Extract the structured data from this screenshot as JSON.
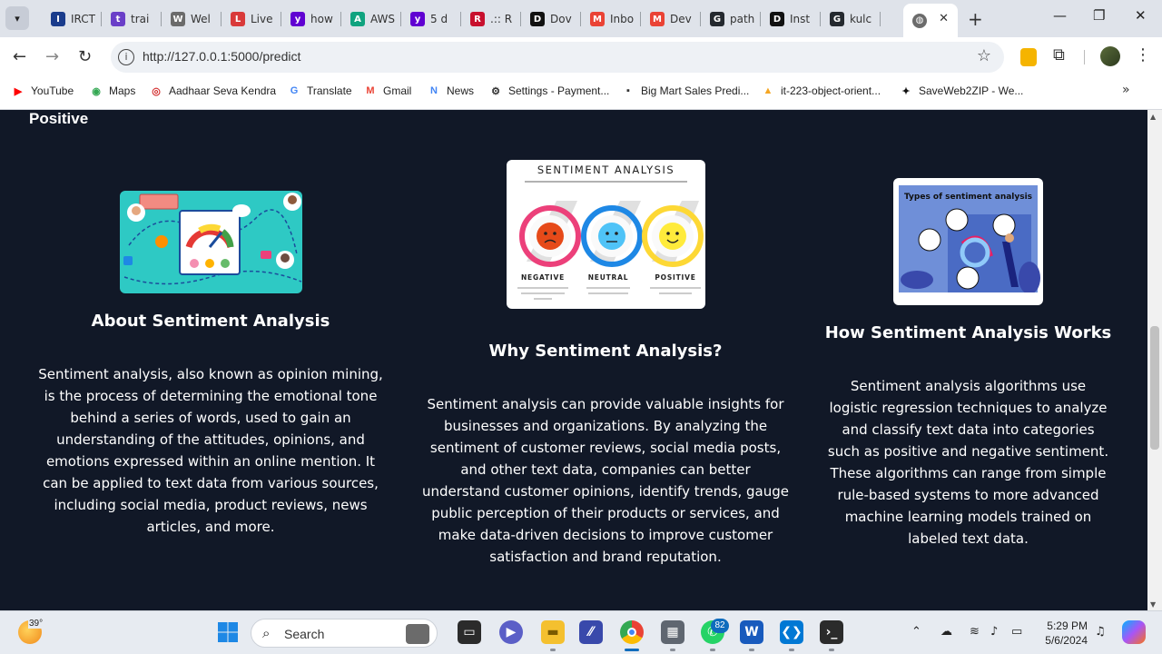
{
  "browser": {
    "tabs": [
      {
        "label": "IRCT",
        "color": "#1a3c8c",
        "glyph": "I"
      },
      {
        "label": "trai",
        "color": "#6a3fc8",
        "glyph": "t"
      },
      {
        "label": "Wel",
        "color": "#6b6b6b",
        "glyph": "W"
      },
      {
        "label": "Live",
        "color": "#d93a3a",
        "glyph": "L"
      },
      {
        "label": "how",
        "color": "#6001d2",
        "glyph": "y"
      },
      {
        "label": "AWS",
        "color": "#10a37f",
        "glyph": "A"
      },
      {
        "label": "5 d",
        "color": "#6001d2",
        "glyph": "y"
      },
      {
        "label": ".:: R",
        "color": "#c8102e",
        "glyph": "R"
      },
      {
        "label": "Dov",
        "color": "#111111",
        "glyph": "D"
      },
      {
        "label": "Inbo",
        "color": "#ea4335",
        "glyph": "M"
      },
      {
        "label": "Dev",
        "color": "#ea4335",
        "glyph": "M"
      },
      {
        "label": "path",
        "color": "#24292f",
        "glyph": "G"
      },
      {
        "label": "Inst",
        "color": "#111111",
        "glyph": "D"
      },
      {
        "label": "kulc",
        "color": "#24292f",
        "glyph": "G"
      }
    ],
    "url": "http://127.0.0.1:5000/predict",
    "bookmarks": [
      {
        "label": "YouTube",
        "icon": "youtube-icon",
        "color": "#ff0000",
        "glyph": "▶"
      },
      {
        "label": "Maps",
        "icon": "maps-icon",
        "color": "#34a853",
        "glyph": "◉"
      },
      {
        "label": "Aadhaar Seva Kendra",
        "icon": "aadhaar-icon",
        "color": "#d32f2f",
        "glyph": "◎"
      },
      {
        "label": "Translate",
        "icon": "translate-icon",
        "color": "#4285f4",
        "glyph": "G"
      },
      {
        "label": "Gmail",
        "icon": "gmail-icon",
        "color": "#ea4335",
        "glyph": "M"
      },
      {
        "label": "News",
        "icon": "news-icon",
        "color": "#4285f4",
        "glyph": "N"
      },
      {
        "label": "Settings - Payment...",
        "icon": "gear-icon",
        "color": "#333333",
        "glyph": "⚙"
      },
      {
        "label": "Big Mart Sales Predi...",
        "icon": "terminal-icon",
        "color": "#333333",
        "glyph": "▪"
      },
      {
        "label": "it-223-object-orient...",
        "icon": "warning-icon",
        "color": "#f5a623",
        "glyph": "▲"
      },
      {
        "label": "SaveWeb2ZIP - We...",
        "icon": "saveweb-icon",
        "color": "#111111",
        "glyph": "✦"
      }
    ]
  },
  "page": {
    "result_label": "Positive",
    "about": {
      "title": "About Sentiment Analysis",
      "body": "Sentiment analysis, also known as opinion mining, is the process of determining the emotional tone behind a series of words, used to gain an understanding of the attitudes, opinions, and emotions expressed within an online mention. It can be applied to text data from various sources, including social media, product reviews, news articles, and more."
    },
    "why": {
      "title": "Why Sentiment Analysis?",
      "body": "Sentiment analysis can provide valuable insights for businesses and organizations. By analyzing the sentiment of customer reviews, social media posts, and other text data, companies can better understand customer opinions, identify trends, gauge public perception of their products or services, and make data-driven decisions to improve customer satisfaction and brand reputation.",
      "image": {
        "heading": "SENTIMENT ANALYSIS",
        "labels": [
          "NEGATIVE",
          "NEUTRAL",
          "POSITIVE"
        ]
      }
    },
    "how": {
      "title": "How Sentiment Analysis Works",
      "body": "Sentiment analysis algorithms use logistic regression techniques to analyze and classify text data into categories such as positive and negative sentiment. These algorithms can range from simple rule-based systems to more advanced machine learning models trained on labeled text data.",
      "image": {
        "heading": "Types of sentiment analysis"
      }
    }
  },
  "taskbar": {
    "temperature": "39°",
    "search_placeholder": "Search",
    "whatsapp_badge": "82",
    "time": "5:29 PM",
    "date": "5/6/2024"
  }
}
